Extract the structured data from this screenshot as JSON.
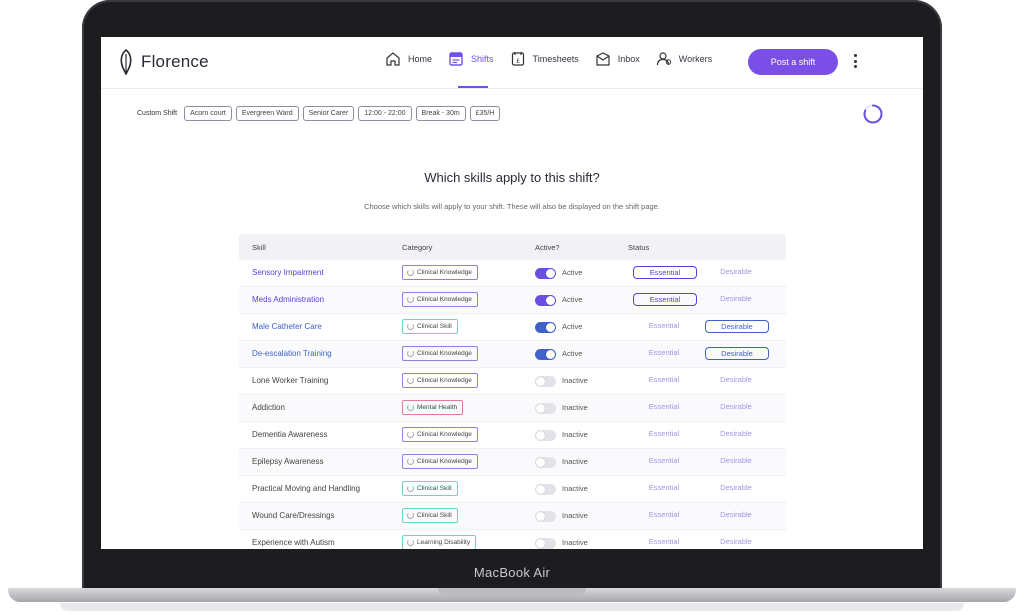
{
  "app": {
    "name": "Florence"
  },
  "nav": {
    "items": [
      {
        "label": "Home",
        "icon": "home-icon"
      },
      {
        "label": "Shifts",
        "icon": "shifts-icon",
        "active": true
      },
      {
        "label": "Timesheets",
        "icon": "timesheets-icon"
      },
      {
        "label": "Inbox",
        "icon": "inbox-icon"
      },
      {
        "label": "Workers",
        "icon": "workers-icon"
      }
    ],
    "post_button": "Post a shift"
  },
  "custom_shift": {
    "label": "Custom Shift",
    "chips": [
      "Acorn court",
      "Evergreen Ward",
      "Senior Carer",
      "12:00 - 22:00",
      "Break - 30m",
      "£35/H"
    ]
  },
  "page": {
    "title": "Which skills apply to this shift?",
    "subtitle": "Choose which skills will apply to your shift. These will also be displayed on the shift page."
  },
  "table": {
    "headers": {
      "skill": "Skill",
      "category": "Category",
      "active": "Active?",
      "status": "Status"
    },
    "options": {
      "essential": "Essential",
      "desirable": "Desirable"
    },
    "rows": [
      {
        "skill": "Sensory Impairment",
        "category": "Clinical Knowledge",
        "cat_type": "k",
        "active": true,
        "state": "Active",
        "status": "essential",
        "color": "purple"
      },
      {
        "skill": "Meds Administration",
        "category": "Clinical Knowledge",
        "cat_type": "k",
        "active": true,
        "state": "Active",
        "status": "essential",
        "color": "purple"
      },
      {
        "skill": "Male Catheter Care",
        "category": "Clinical Skill",
        "cat_type": "s",
        "active": true,
        "state": "Active",
        "status": "desirable",
        "color": "blue"
      },
      {
        "skill": "De-escalation Training",
        "category": "Clinical Knowledge",
        "cat_type": "k",
        "active": true,
        "state": "Active",
        "status": "desirable",
        "color": "blue"
      },
      {
        "skill": "Lone Worker Training",
        "category": "Clinical Knowledge",
        "cat_type": "k",
        "active": false,
        "state": "Inactive",
        "status": "none",
        "color": "gray"
      },
      {
        "skill": "Addiction",
        "category": "Mental Health",
        "cat_type": "m",
        "active": false,
        "state": "Inactive",
        "status": "none",
        "color": "gray"
      },
      {
        "skill": "Dementia Awareness",
        "category": "Clinical Knowledge",
        "cat_type": "k",
        "active": false,
        "state": "Inactive",
        "status": "none",
        "color": "gray"
      },
      {
        "skill": "Epilepsy Awareness",
        "category": "Clinical Knowledge",
        "cat_type": "k",
        "active": false,
        "state": "Inactive",
        "status": "none",
        "color": "gray"
      },
      {
        "skill": "Practical Moving and Handling",
        "category": "Clinical Skill",
        "cat_type": "s",
        "active": false,
        "state": "Inactive",
        "status": "none",
        "color": "gray"
      },
      {
        "skill": "Wound Care/Dressings",
        "category": "Clinical Skill",
        "cat_type": "s",
        "active": false,
        "state": "Inactive",
        "status": "none",
        "color": "gray"
      },
      {
        "skill": "Experience with Autism",
        "category": "Learning Disability",
        "cat_type": "l",
        "active": false,
        "state": "Inactive",
        "status": "none",
        "color": "gray"
      }
    ]
  },
  "device": {
    "label": "MacBook Air"
  },
  "colors": {
    "accent": "#7a4fe8",
    "blue": "#3f61c9"
  }
}
